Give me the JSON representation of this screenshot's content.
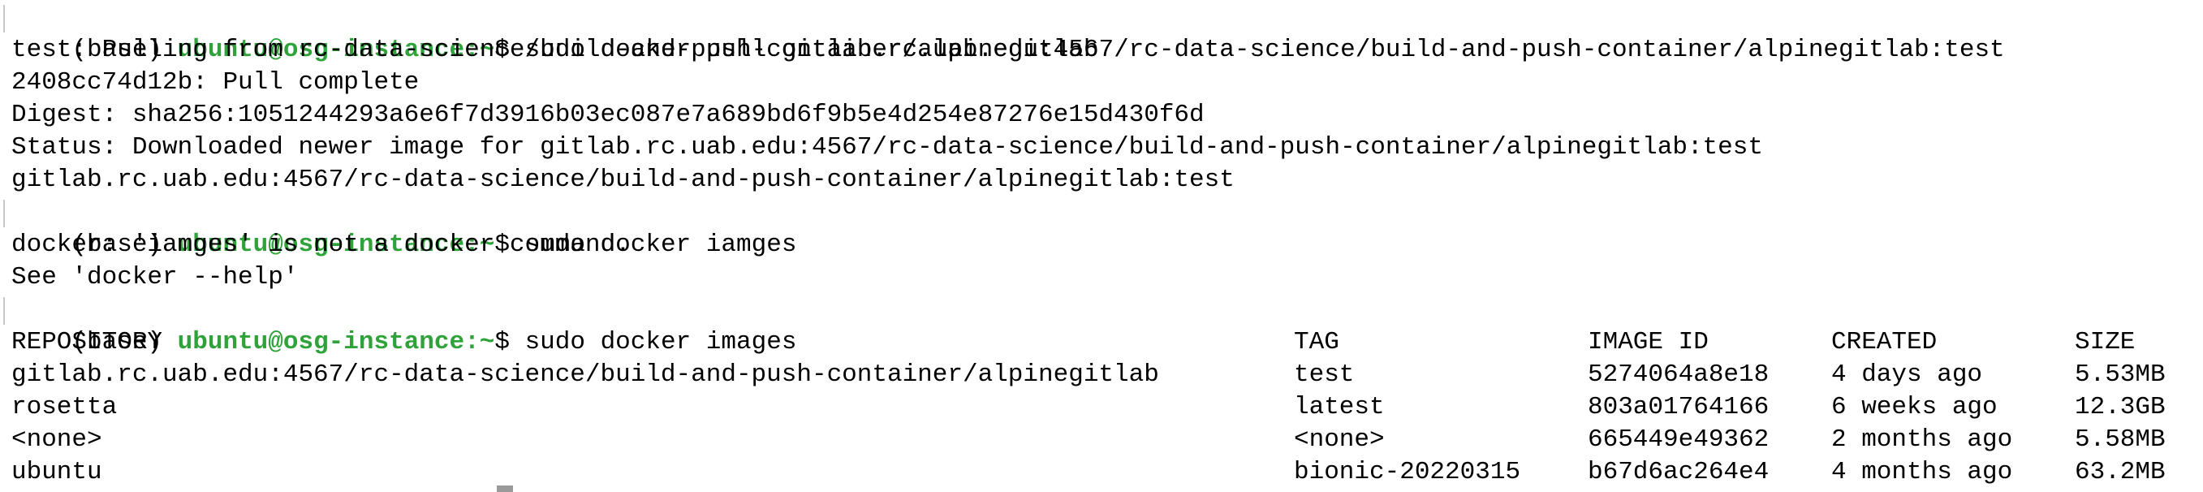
{
  "prompt": {
    "env": "(base) ",
    "user": "ubuntu@osg-instance",
    "path_sep": ":~",
    "symbol": "$ "
  },
  "commands": {
    "pull": "sudo docker pull gitlab.rc.uab.edu:4567/rc-data-science/build-and-push-container/alpinegitlab:test",
    "typo": "sudo docker iamges",
    "images": "sudo docker images"
  },
  "pull_output": [
    "test: Pulling from rc-data-science/build-and-push-container/alpinegitlab",
    "2408cc74d12b: Pull complete",
    "Digest: sha256:1051244293a6e6f7d3916b03ec087e7a689bd6f9b5e4d254e87276e15d430f6d",
    "Status: Downloaded newer image for gitlab.rc.uab.edu:4567/rc-data-science/build-and-push-container/alpinegitlab:test",
    "gitlab.rc.uab.edu:4567/rc-data-science/build-and-push-container/alpinegitlab:test"
  ],
  "typo_output": [
    "docker: 'iamges' is not a docker command.",
    "See 'docker --help'"
  ],
  "images_table": {
    "headers": [
      "REPOSITORY",
      "TAG",
      "IMAGE ID",
      "CREATED",
      "SIZE"
    ],
    "rows": [
      [
        "gitlab.rc.uab.edu:4567/rc-data-science/build-and-push-container/alpinegitlab",
        "test",
        "5274064a8e18",
        "4 days ago",
        "5.53MB"
      ],
      [
        "rosetta",
        "latest",
        "803a01764166",
        "6 weeks ago",
        "12.3GB"
      ],
      [
        "<none>",
        "<none>",
        "665449e49362",
        "2 months ago",
        "5.58MB"
      ],
      [
        "ubuntu",
        "bionic-20220315",
        "b67d6ac264e4",
        "4 months ago",
        "63.2MB"
      ]
    ]
  },
  "colors": {
    "background": "#ffffff",
    "text": "#000000",
    "prompt_user": "#2fa33a"
  }
}
